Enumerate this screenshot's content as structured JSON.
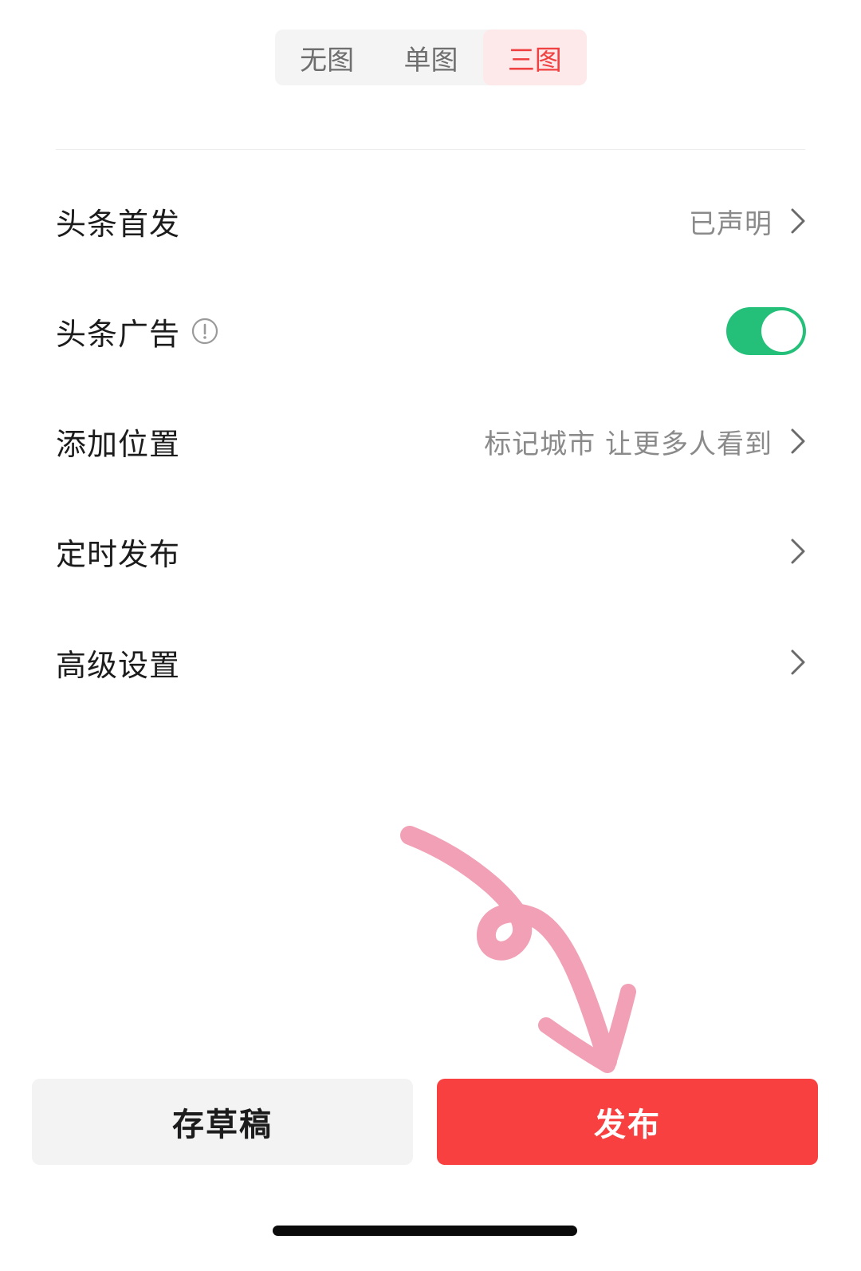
{
  "segmented": {
    "options": [
      "无图",
      "单图",
      "三图"
    ],
    "selected": "三图"
  },
  "rows": {
    "first_publish": {
      "label": "头条首发",
      "value": "已声明"
    },
    "ads": {
      "label": "头条广告",
      "toggle_on": true
    },
    "location": {
      "label": "添加位置",
      "value": "标记城市 让更多人看到"
    },
    "schedule": {
      "label": "定时发布"
    },
    "advanced": {
      "label": "高级设置"
    }
  },
  "buttons": {
    "draft_label": "存草稿",
    "publish_label": "发布"
  },
  "colors": {
    "accent_red": "#f7403f",
    "segment_active_text": "#f04142",
    "toggle_green": "#24c079",
    "annotation_pink": "#f1a0b5"
  },
  "icons": {
    "info": "info-circle-icon",
    "chevron": "chevron-right-icon"
  }
}
